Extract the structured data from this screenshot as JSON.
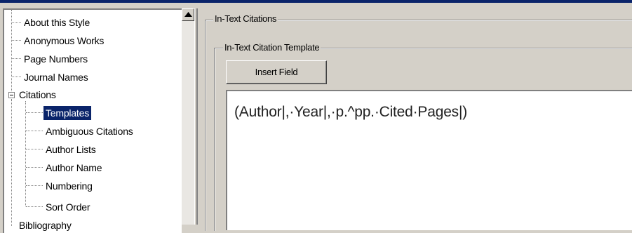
{
  "tree": {
    "items": [
      {
        "label": "About this Style",
        "level": 1
      },
      {
        "label": "Anonymous Works",
        "level": 1
      },
      {
        "label": "Page Numbers",
        "level": 1
      },
      {
        "label": "Journal Names",
        "level": 1
      },
      {
        "label": "Citations",
        "level": 0,
        "expanded": true
      },
      {
        "label": "Templates",
        "level": 2,
        "selected": true
      },
      {
        "label": "Ambiguous Citations",
        "level": 2
      },
      {
        "label": "Author Lists",
        "level": 2
      },
      {
        "label": "Author Name",
        "level": 2
      },
      {
        "label": "Numbering",
        "level": 2
      },
      {
        "label": "Sort Order",
        "level": 2
      },
      {
        "label": "Bibliography",
        "level": 0
      }
    ]
  },
  "scrollbar": {
    "up_icon": "scroll-up-arrow"
  },
  "panel": {
    "outer_group_title": "In-Text Citations",
    "inner_group_title": "In-Text Citation Template",
    "insert_field_label": "Insert Field",
    "template_text": "(Author|,·Year|,·p.^pp.·Cited·Pages|)"
  },
  "colors": {
    "selection": "#0a246a",
    "window_bg": "#d4d0c8",
    "accent_bar": "#0a246a"
  }
}
